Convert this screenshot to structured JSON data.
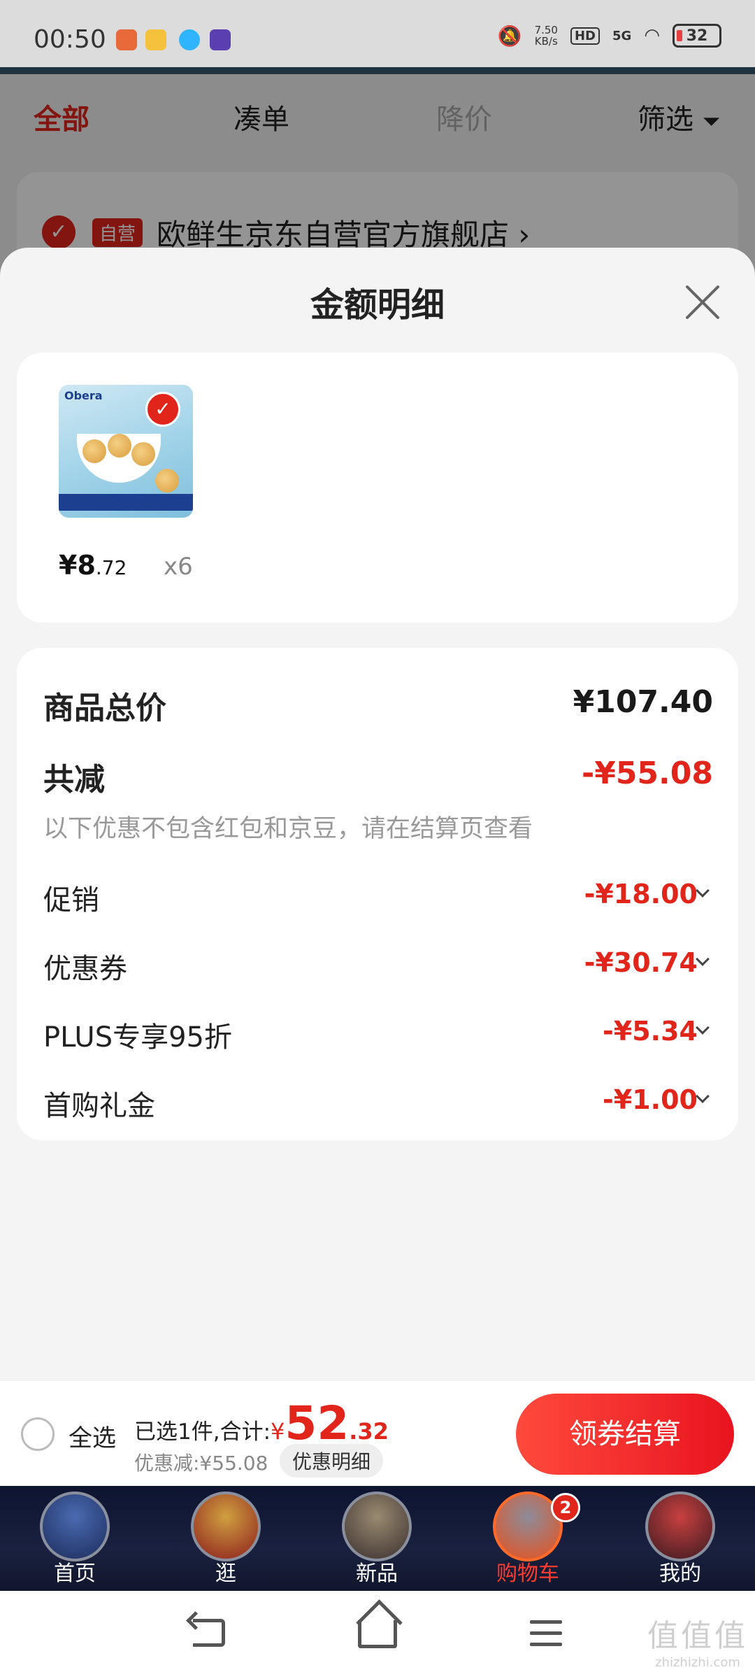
{
  "status_bar": {
    "time": "00:50",
    "speed_value": "7.50",
    "speed_unit": "KB/s",
    "hd": "HD",
    "network": "5G",
    "battery": "32"
  },
  "top_filters": {
    "all": "全部",
    "bundle": "凑单",
    "price_drop": "降价",
    "filter": "筛选"
  },
  "store": {
    "tag": "自营",
    "name": "欧鲜生京东自营官方旗舰店 ›"
  },
  "sheet": {
    "title": "金额明细",
    "product": {
      "brand": "Obera",
      "price_int": "¥8",
      "price_dec": ".72",
      "quantity": "x6"
    },
    "summary": {
      "total_label": "商品总价",
      "total_value": "¥107.40",
      "reduce_label": "共减",
      "reduce_value": "-¥55.08",
      "note": "以下优惠不包含红包和京豆，请在结算页查看"
    },
    "discounts": [
      {
        "label": "促销",
        "value": "-¥18.00"
      },
      {
        "label": "优惠券",
        "value": "-¥30.74"
      },
      {
        "label": "PLUS专享95折",
        "value": "-¥5.34"
      },
      {
        "label": "首购礼金",
        "value": "-¥1.00"
      }
    ]
  },
  "checkout": {
    "select_all": "全选",
    "selected_text": "已选1件,合计:",
    "currency": "¥",
    "total_int": "52",
    "total_dec": ".32",
    "discount_text": "优惠减:¥55.08",
    "detail_button": "优惠明细",
    "checkout_button": "领券结算"
  },
  "tabbar": {
    "tabs": [
      {
        "label": "首页"
      },
      {
        "label": "逛"
      },
      {
        "label": "新品"
      },
      {
        "label": "购物车",
        "badge": "2",
        "active": true
      },
      {
        "label": "我的"
      }
    ]
  },
  "watermark": {
    "big": "值值值",
    "small": "zhizhizhi.com"
  },
  "colors": {
    "accent_red": "#e1251b",
    "tabbar_bg": "#0d1430"
  }
}
